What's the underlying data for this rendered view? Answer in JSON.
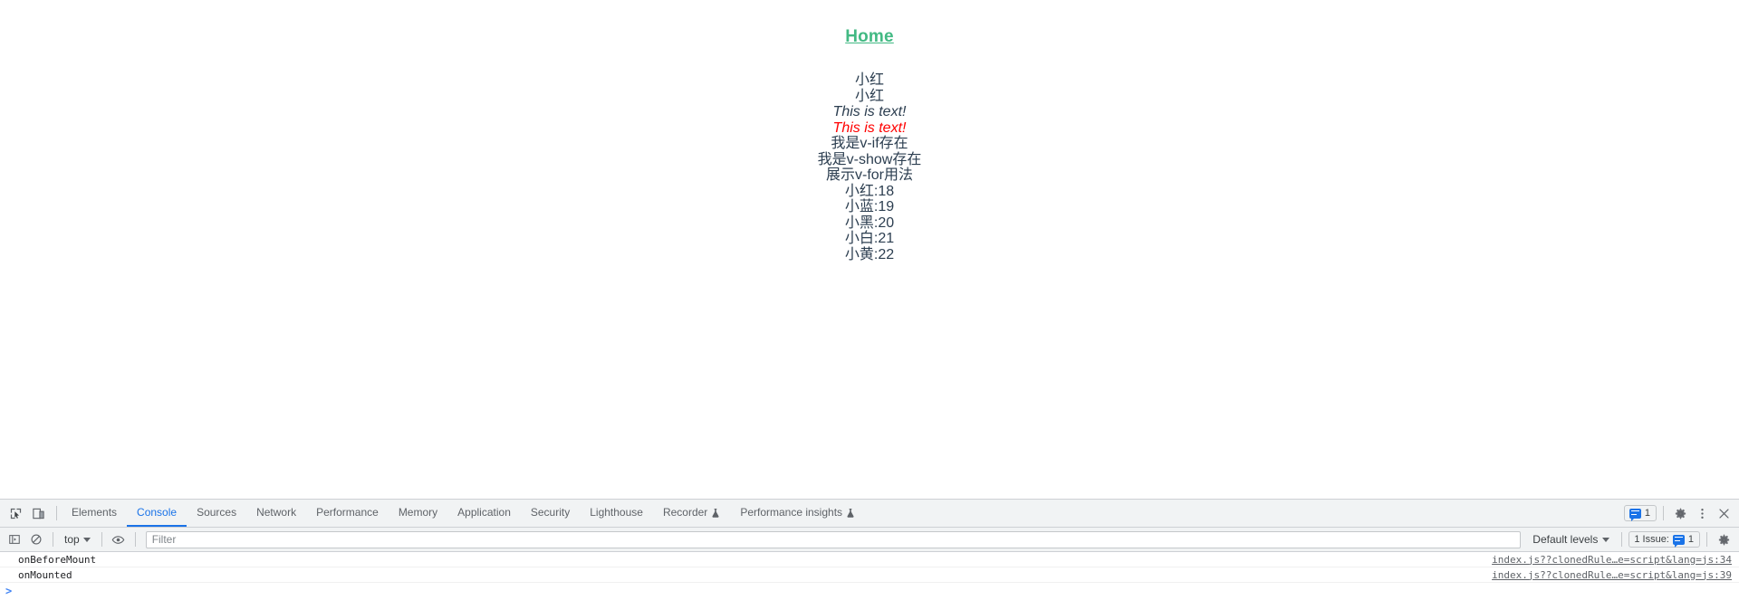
{
  "page": {
    "nav": {
      "home_label": "Home"
    },
    "lines": [
      {
        "text": "小红",
        "style": "plain"
      },
      {
        "text": "小红",
        "style": "plain"
      },
      {
        "text": "This is text!",
        "style": "italic"
      },
      {
        "text": "This is text!",
        "style": "italic-red"
      },
      {
        "text": "我是v-if存在",
        "style": "plain"
      },
      {
        "text": "我是v-show存在",
        "style": "plain"
      },
      {
        "text": "展示v-for用法",
        "style": "plain"
      }
    ],
    "vfor_items": [
      "小红:18",
      "小蓝:19",
      "小黑:20",
      "小白:21",
      "小黄:22"
    ],
    "colors": {
      "link_green": "#42b983",
      "text_dark": "#2c3e50",
      "red": "#ff0000"
    }
  },
  "devtools": {
    "tabs": [
      {
        "label": "Elements",
        "active": false,
        "experimental": false
      },
      {
        "label": "Console",
        "active": true,
        "experimental": false
      },
      {
        "label": "Sources",
        "active": false,
        "experimental": false
      },
      {
        "label": "Network",
        "active": false,
        "experimental": false
      },
      {
        "label": "Performance",
        "active": false,
        "experimental": false
      },
      {
        "label": "Memory",
        "active": false,
        "experimental": false
      },
      {
        "label": "Application",
        "active": false,
        "experimental": false
      },
      {
        "label": "Security",
        "active": false,
        "experimental": false
      },
      {
        "label": "Lighthouse",
        "active": false,
        "experimental": false
      },
      {
        "label": "Recorder",
        "active": false,
        "experimental": true
      },
      {
        "label": "Performance insights",
        "active": false,
        "experimental": true
      }
    ],
    "icons": {
      "inspect": "inspect-element-icon",
      "device": "device-toolbar-icon",
      "settings": "gear-icon",
      "more": "kebab-menu-icon",
      "close": "close-icon",
      "sidebar": "console-sidebar-icon",
      "clear": "clear-console-icon",
      "eye": "live-expression-icon"
    },
    "messages_badge_count": "1",
    "console_toolbar": {
      "context": "top",
      "filter_placeholder": "Filter",
      "filter_value": "",
      "levels": "Default levels",
      "issues_label": "1 Issue:",
      "issues_count": "1"
    },
    "console_messages": [
      {
        "text": "onBeforeMount",
        "source": "index.js??clonedRule…e=script&lang=js:34"
      },
      {
        "text": "onMounted",
        "source": "index.js??clonedRule…e=script&lang=js:39"
      }
    ],
    "prompt": ">"
  }
}
